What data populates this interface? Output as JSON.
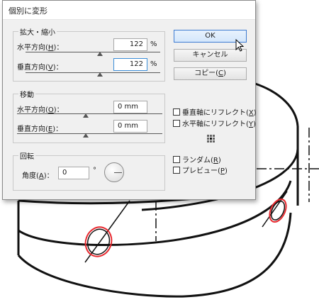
{
  "dialog": {
    "title": "個別に変形",
    "scale": {
      "legend": "拡大・縮小",
      "horizontal": {
        "label": "水平方向(",
        "key": "H",
        "tail": ")：",
        "value": "122",
        "unit": "%",
        "slider_fraction": 0.5
      },
      "vertical": {
        "label": "垂直方向(",
        "key": "V",
        "tail": ")：",
        "value": "122",
        "unit": "%",
        "slider_fraction": 0.5
      }
    },
    "move": {
      "legend": "移動",
      "horizontal": {
        "label": "水平方向(",
        "key": "O",
        "tail": ")：",
        "value": "0 mm",
        "slider_fraction": 0.5
      },
      "vertical": {
        "label": "垂直方向(",
        "key": "E",
        "tail": ")：",
        "value": "0 mm",
        "slider_fraction": 0.5
      }
    },
    "rotate": {
      "legend": "回転",
      "angle_label": "角度(",
      "angle_key": "A",
      "angle_tail": ")：",
      "angle_value": "0",
      "degree": "°"
    },
    "buttons": {
      "ok": "OK",
      "cancel": "キャンセル",
      "copy": "コピー(",
      "copy_key": "C",
      "copy_tail": ")"
    },
    "options": {
      "reflect_vertical": {
        "label": "垂直軸にリフレクト(",
        "key": "X",
        "tail": ")",
        "checked": false
      },
      "reflect_horizontal": {
        "label": "水平軸にリフレクト(",
        "key": "Y",
        "tail": ")",
        "checked": false
      },
      "random": {
        "label": "ランダム(",
        "key": "R",
        "tail": ")",
        "checked": false
      },
      "preview": {
        "label": "プレビュー(",
        "key": "P",
        "tail": ")",
        "checked": false
      }
    }
  },
  "colors": {
    "ok_border": "#3d7bd1",
    "selection_ellipse": "#e8292f",
    "drawing_stroke": "#111111"
  }
}
